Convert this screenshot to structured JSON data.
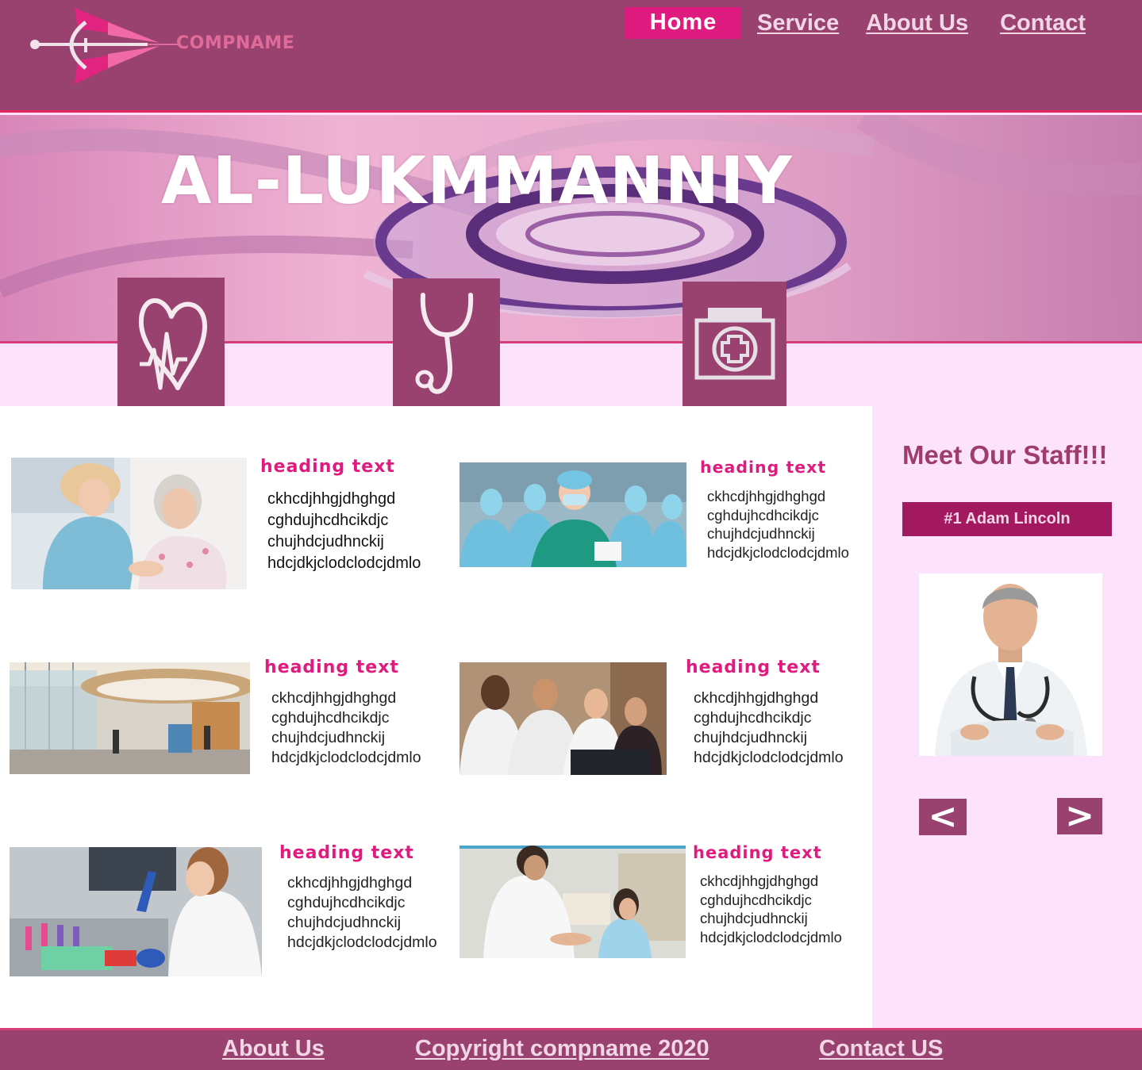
{
  "brand": {
    "name": "COMPNAME"
  },
  "nav": {
    "items": [
      {
        "label": "Home",
        "active": true
      },
      {
        "label": "Service"
      },
      {
        "label": "About Us"
      },
      {
        "label": "Contact"
      }
    ]
  },
  "hero": {
    "title": "AL-LUKMMANNIY"
  },
  "features": [
    {
      "icon": "heart-pulse-icon"
    },
    {
      "icon": "stethoscope-icon"
    },
    {
      "icon": "medical-kit-icon"
    }
  ],
  "cards": [
    {
      "heading": "heading text",
      "lines": [
        "ckhcdjhhgjdhghgd",
        "cghdujhcdhcikdjc",
        "chujhdcjudhnckij",
        "hdcjdkjclodclodcjdmlo"
      ],
      "image": "nurse-with-patient-photo"
    },
    {
      "heading": "heading text",
      "lines": [
        "ckhcdjhhgjdhghgd",
        "cghdujhcdhcikdjc",
        "chujhdcjudhnckij",
        "hdcjdkjclodclodcjdmlo"
      ],
      "image": "surgical-team-photo"
    },
    {
      "heading": "heading text",
      "lines": [
        "ckhcdjhhgjdhghgd",
        "cghdujhcdhcikdjc",
        "chujhdcjudhnckij",
        "hdcjdkjclodclodcjdmlo"
      ],
      "image": "hospital-lobby-photo"
    },
    {
      "heading": "heading text",
      "lines": [
        "ckhcdjhhgjdhghgd",
        "cghdujhcdhcikdjc",
        "chujhdcjudhnckij",
        "hdcjdkjclodclodcjdmlo"
      ],
      "image": "doctors-at-computer-photo"
    },
    {
      "heading": "heading text",
      "lines": [
        "ckhcdjhhgjdhghgd",
        "cghdujhcdhcikdjc",
        "chujhdcjudhnckij",
        "hdcjdkjclodclodcjdmlo"
      ],
      "image": "lab-researcher-photo"
    },
    {
      "heading": "heading text",
      "lines": [
        "ckhcdjhhgjdhghgd",
        "cghdujhcdhcikdjc",
        "chujhdcjudhnckij",
        "hdcjdkjclodclodcjdmlo"
      ],
      "image": "doctor-with-child-photo"
    }
  ],
  "staff": {
    "title": "Meet Our Staff!!!",
    "name": "#1  Adam Lincoln",
    "prev": "<",
    "next": ">"
  },
  "footer": {
    "about": "About Us",
    "copyright": "Copyright compname 2020",
    "contact": "Contact US"
  },
  "colors": {
    "header": "#99426f",
    "accent": "#e01b7f",
    "sidebar_bg": "#fce3fb"
  }
}
